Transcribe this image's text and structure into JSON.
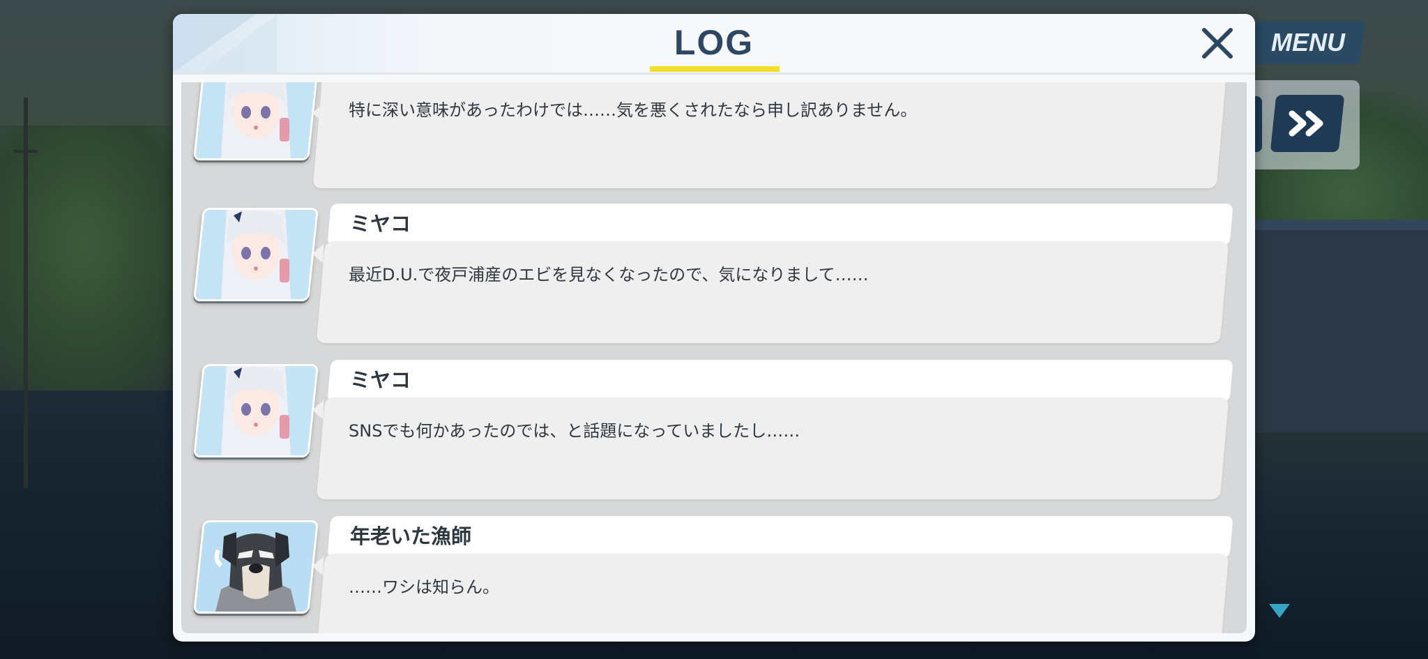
{
  "window": {
    "title": "LOG",
    "close_label": "×"
  },
  "hud": {
    "menu_label": "MENU"
  },
  "log_entries": [
    {
      "speaker": "",
      "portrait": "miyako-portrait",
      "text": "特に深い意味があったわけでは……気を悪くされたなら申し訳ありません。"
    },
    {
      "speaker": "ミヤコ",
      "portrait": "miyako-portrait",
      "text": "最近D.U.で夜戸浦産のエビを見なくなったので、気になりまして……"
    },
    {
      "speaker": "ミヤコ",
      "portrait": "miyako-portrait",
      "text": "SNSでも何かあったのでは、と話題になっていましたし……"
    },
    {
      "speaker": "年老いた漁師",
      "portrait": "old-fisherman-dog-portrait",
      "text": "……ワシは知らん。"
    }
  ],
  "colors": {
    "title": "#2d4663",
    "title_underline": "#f5dd2e",
    "menu_bg": "#2a4a63",
    "next_arrow": "#37a6c6"
  }
}
